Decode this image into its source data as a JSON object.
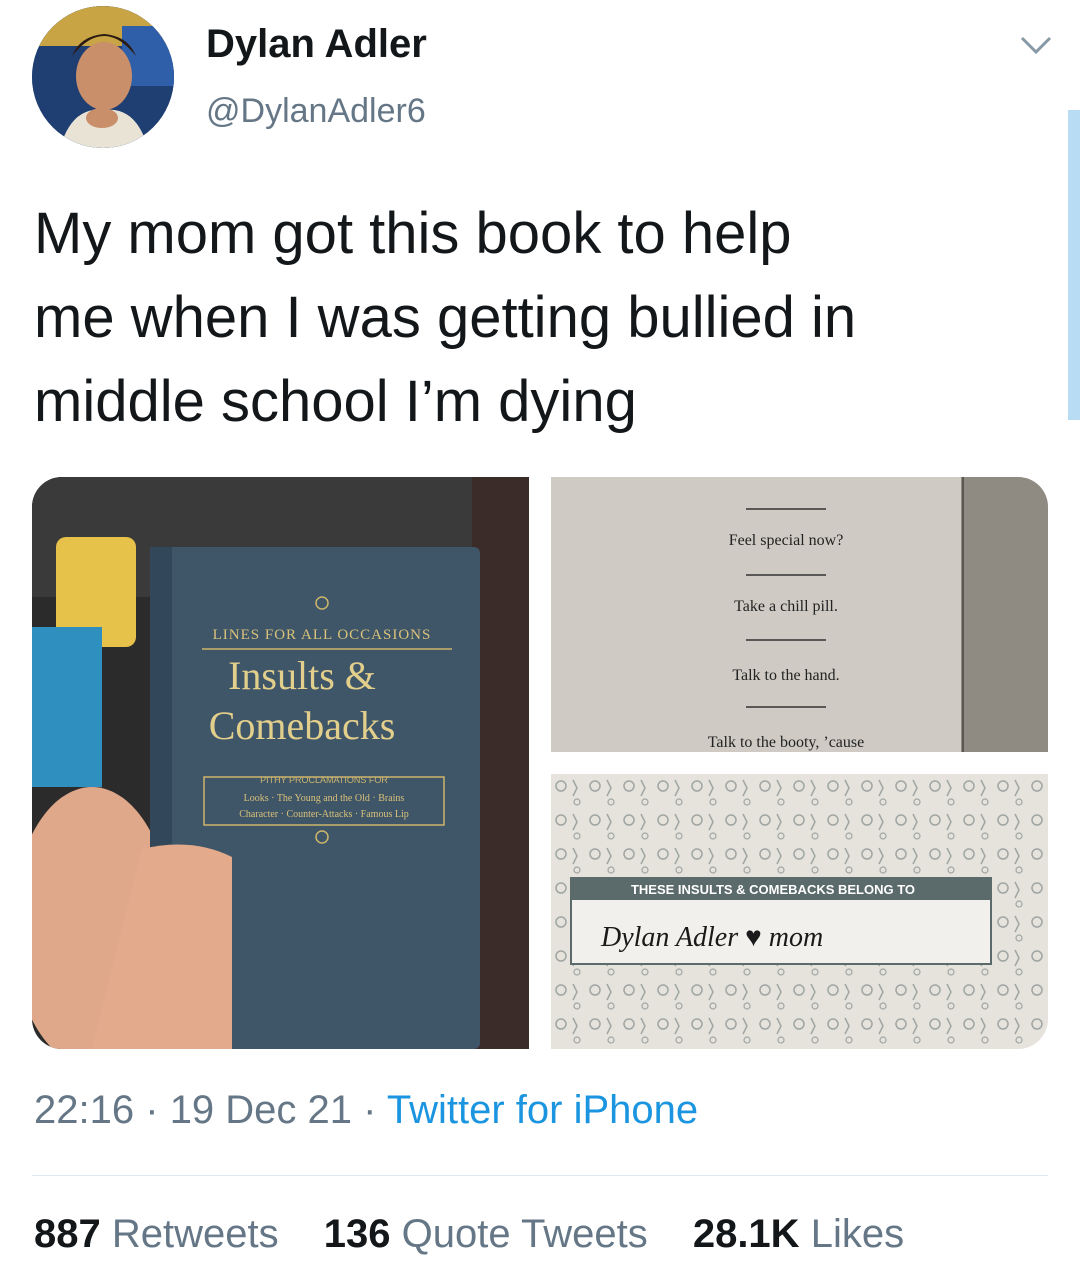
{
  "author": {
    "name": "Dylan Adler",
    "handle": "@DylanAdler6"
  },
  "tweet": {
    "text": "My mom got this book to help\nme when I was getting bullied in\nmiddle school I’m dying"
  },
  "media": {
    "book_cover": {
      "banner": "LINES FOR ALL OCCASIONS",
      "title_line1": "Insults &",
      "title_line2": "Comebacks",
      "sub_heading": "PITHY PROCLAMATIONS FOR",
      "sub_line1": "Looks · The Young and the Old · Brains",
      "sub_line2": "Character · Counter-Attacks · Famous Lip"
    },
    "book_page": {
      "lines": [
        "Feel special now?",
        "Take a chill pill.",
        "Talk to the hand.",
        "Talk to the booty, ’cause"
      ]
    },
    "bookplate": {
      "caption": "THESE INSULTS & COMEBACKS BELONG TO",
      "handwritten": "Dylan Adler ♥ mom"
    }
  },
  "meta": {
    "time": "22:16",
    "sep1": "·",
    "date": "19 Dec 21",
    "sep2": "·",
    "source": "Twitter for iPhone"
  },
  "stats": {
    "retweets_count": "887",
    "retweets_label": "Retweets",
    "quotes_count": "136",
    "quotes_label": "Quote Tweets",
    "likes_count": "28.1K",
    "likes_label": "Likes"
  },
  "colors": {
    "text": "#14171a",
    "secondary": "#657786",
    "link": "#1b95e0"
  }
}
